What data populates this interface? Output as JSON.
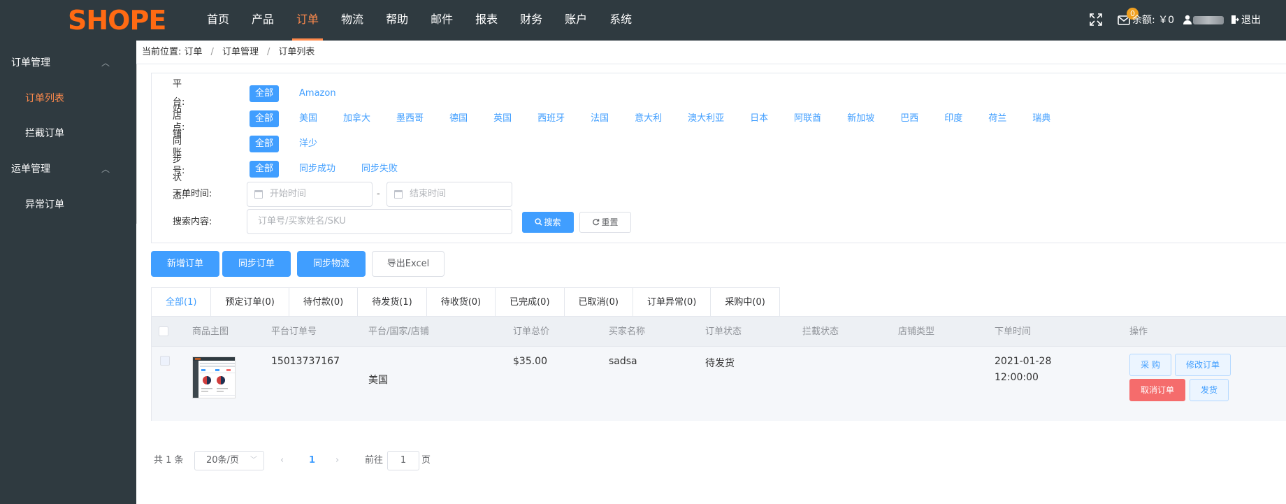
{
  "brand": {
    "logo_text": "SHOPE",
    "logo_color": "#ff6a13"
  },
  "nav": {
    "items": [
      {
        "label": "首页",
        "active": false
      },
      {
        "label": "产品",
        "active": false
      },
      {
        "label": "订单",
        "active": true
      },
      {
        "label": "物流",
        "active": false
      },
      {
        "label": "帮助",
        "active": false
      },
      {
        "label": "邮件",
        "active": false
      },
      {
        "label": "报表",
        "active": false
      },
      {
        "label": "财务",
        "active": false
      },
      {
        "label": "账户",
        "active": false
      },
      {
        "label": "系统",
        "active": false
      }
    ]
  },
  "topright": {
    "mail_badge": "0",
    "balance_label": "余额: ￥0",
    "logout_label": "退出"
  },
  "sidebar": {
    "groups": [
      {
        "label": "订单管理",
        "items": [
          {
            "label": "订单列表",
            "active": true
          },
          {
            "label": "拦截订单",
            "active": false
          }
        ]
      },
      {
        "label": "运单管理",
        "items": [
          {
            "label": "异常订单",
            "active": false
          }
        ]
      }
    ]
  },
  "breadcrumb": {
    "prefix": "当前位置:",
    "items": [
      "订单",
      "订单管理",
      "订单列表"
    ]
  },
  "filters": {
    "platform": {
      "label": "平台:",
      "options": [
        "全部",
        "Amazon"
      ]
    },
    "site": {
      "label": "站点:",
      "options": [
        "全部",
        "美国",
        "加拿大",
        "墨西哥",
        "德国",
        "英国",
        "西班牙",
        "法国",
        "意大利",
        "澳大利亚",
        "日本",
        "阿联酋",
        "新加坡",
        "巴西",
        "印度",
        "荷兰",
        "瑞典"
      ]
    },
    "shop": {
      "label": "店铺账号:",
      "options": [
        "全部",
        "洋少"
      ]
    },
    "sync": {
      "label": "同步状态:",
      "options": [
        "全部",
        "同步成功",
        "同步失败"
      ]
    },
    "order_time": {
      "label": "下单时间:",
      "start_placeholder": "开始时间",
      "end_placeholder": "结束时间",
      "dash": "-"
    },
    "search": {
      "label": "搜索内容:",
      "placeholder": "订单号/买家姓名/SKU",
      "search_label": "搜索",
      "reset_label": "重置"
    }
  },
  "actions": {
    "add": "新增订单",
    "sync_order": "同步订单",
    "sync_logistics": "同步物流",
    "export": "导出Excel"
  },
  "tabs": [
    "全部(1)",
    "预定订单(0)",
    "待付款(0)",
    "待发货(1)",
    "待收货(0)",
    "已完成(0)",
    "已取消(0)",
    "订单异常(0)",
    "采购中(0)"
  ],
  "table": {
    "headers": [
      "商品主图",
      "平台订单号",
      "平台/国家/店铺",
      "订单总价",
      "买家名称",
      "订单状态",
      "拦截状态",
      "店铺类型",
      "下单时间",
      "操作"
    ],
    "rows": [
      {
        "order_no": "15013737167",
        "country": "美国",
        "total": "$35.00",
        "buyer": "sadsa",
        "status": "待发货",
        "date": "2021-01-28",
        "time": "12:00:00",
        "ops": {
          "purchase": "采 购",
          "modify": "修改订单",
          "cancel": "取消订单",
          "ship": "发货"
        }
      }
    ]
  },
  "pagination": {
    "total": "共 1 条",
    "page_size": "20条/页",
    "current": "1",
    "goto_label": "前往",
    "goto_value": "1",
    "page_suffix": "页"
  }
}
